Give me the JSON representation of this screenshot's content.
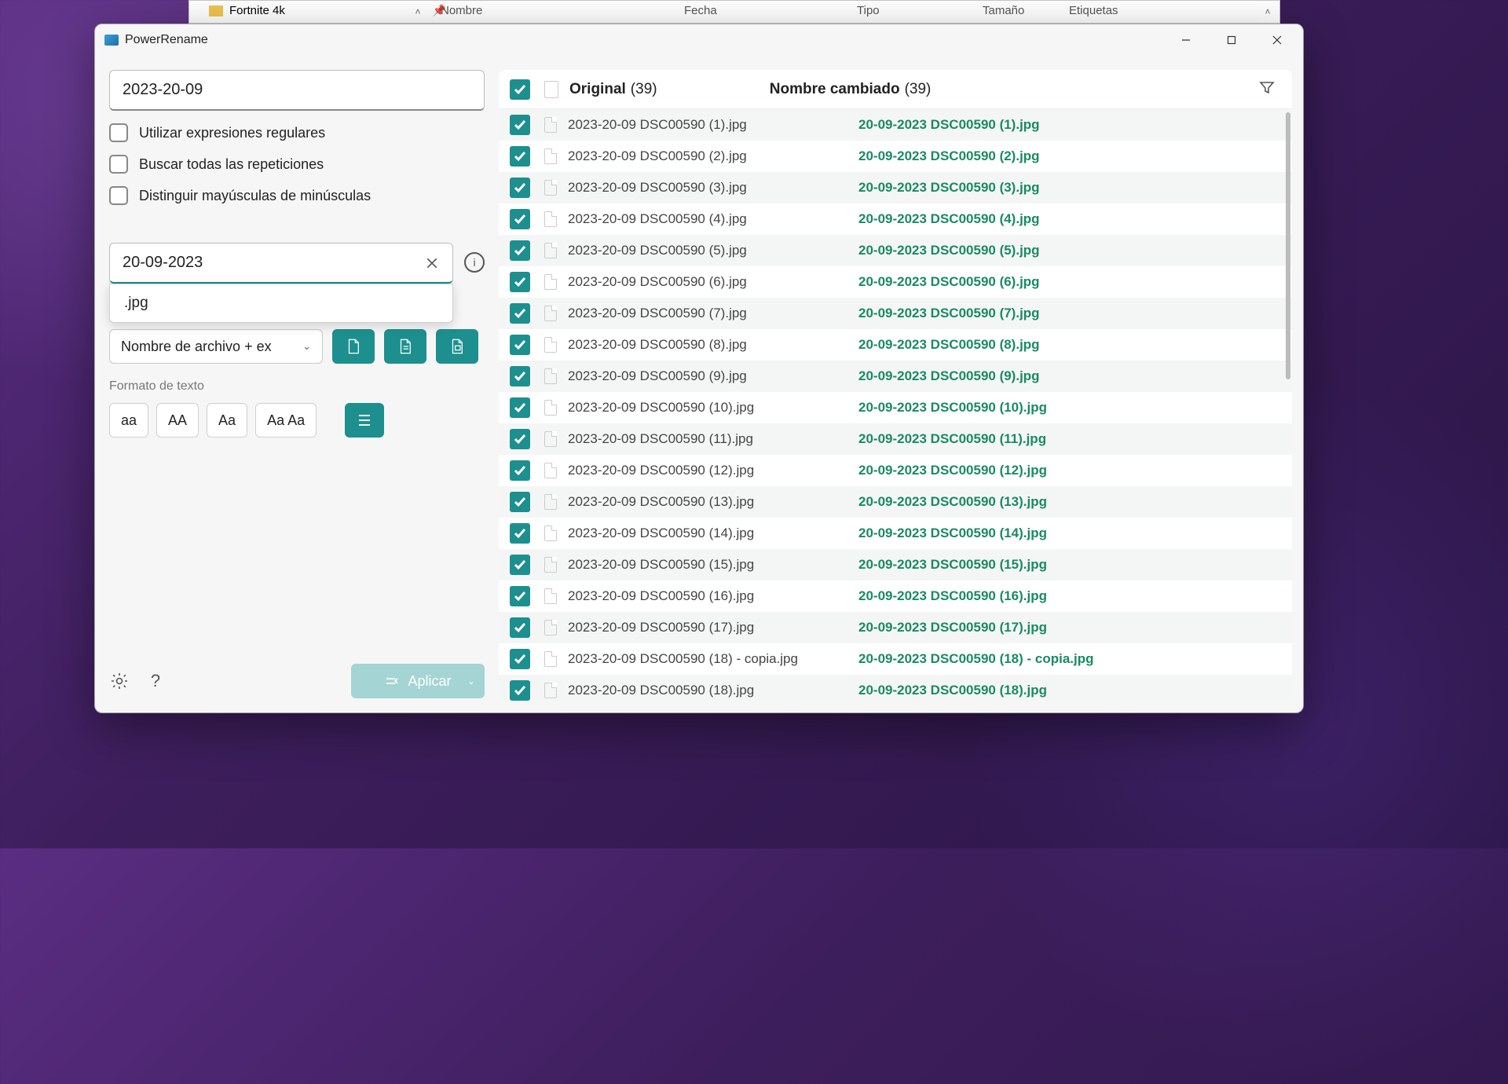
{
  "explorer": {
    "folder": "Fortnite 4k",
    "columns": {
      "name": "Nombre",
      "date": "Fecha",
      "type": "Tipo",
      "size": "Tamaño",
      "tags": "Etiquetas"
    }
  },
  "window": {
    "title": "PowerRename"
  },
  "search": {
    "value": "2023-20-09"
  },
  "options": {
    "regex": "Utilizar expresiones regulares",
    "all_matches": "Buscar todas las repeticiones",
    "case_sensitive": "Distinguir mayúsculas de minúsculas"
  },
  "replace": {
    "value": "20-09-2023",
    "suggestion": ".jpg"
  },
  "apply_to": {
    "label": "Nombre de archivo + ex"
  },
  "format_label": "Formato de texto",
  "format_buttons": {
    "lower": "aa",
    "upper": "AA",
    "title1": "Aa",
    "title2": "Aa Aa"
  },
  "apply_button": "Aplicar",
  "list": {
    "original_label": "Original",
    "renamed_label": "Nombre cambiado",
    "count_original": "(39)",
    "count_renamed": "(39)"
  },
  "rows": [
    {
      "orig": "2023-20-09 DSC00590 (1).jpg",
      "ren": "20-09-2023 DSC00590 (1).jpg"
    },
    {
      "orig": "2023-20-09 DSC00590 (2).jpg",
      "ren": "20-09-2023 DSC00590 (2).jpg"
    },
    {
      "orig": "2023-20-09 DSC00590 (3).jpg",
      "ren": "20-09-2023 DSC00590 (3).jpg"
    },
    {
      "orig": "2023-20-09 DSC00590 (4).jpg",
      "ren": "20-09-2023 DSC00590 (4).jpg"
    },
    {
      "orig": "2023-20-09 DSC00590 (5).jpg",
      "ren": "20-09-2023 DSC00590 (5).jpg"
    },
    {
      "orig": "2023-20-09 DSC00590 (6).jpg",
      "ren": "20-09-2023 DSC00590 (6).jpg"
    },
    {
      "orig": "2023-20-09 DSC00590 (7).jpg",
      "ren": "20-09-2023 DSC00590 (7).jpg"
    },
    {
      "orig": "2023-20-09 DSC00590 (8).jpg",
      "ren": "20-09-2023 DSC00590 (8).jpg"
    },
    {
      "orig": "2023-20-09 DSC00590 (9).jpg",
      "ren": "20-09-2023 DSC00590 (9).jpg"
    },
    {
      "orig": "2023-20-09 DSC00590 (10).jpg",
      "ren": "20-09-2023 DSC00590 (10).jpg"
    },
    {
      "orig": "2023-20-09 DSC00590 (11).jpg",
      "ren": "20-09-2023 DSC00590 (11).jpg"
    },
    {
      "orig": "2023-20-09 DSC00590 (12).jpg",
      "ren": "20-09-2023 DSC00590 (12).jpg"
    },
    {
      "orig": "2023-20-09 DSC00590 (13).jpg",
      "ren": "20-09-2023 DSC00590 (13).jpg"
    },
    {
      "orig": "2023-20-09 DSC00590 (14).jpg",
      "ren": "20-09-2023 DSC00590 (14).jpg"
    },
    {
      "orig": "2023-20-09 DSC00590 (15).jpg",
      "ren": "20-09-2023 DSC00590 (15).jpg"
    },
    {
      "orig": "2023-20-09 DSC00590 (16).jpg",
      "ren": "20-09-2023 DSC00590 (16).jpg"
    },
    {
      "orig": "2023-20-09 DSC00590 (17).jpg",
      "ren": "20-09-2023 DSC00590 (17).jpg"
    },
    {
      "orig": "2023-20-09 DSC00590 (18) - copia.jpg",
      "ren": "20-09-2023 DSC00590 (18) - copia.jpg"
    },
    {
      "orig": "2023-20-09 DSC00590 (18).jpg",
      "ren": "20-09-2023 DSC00590 (18).jpg"
    }
  ]
}
